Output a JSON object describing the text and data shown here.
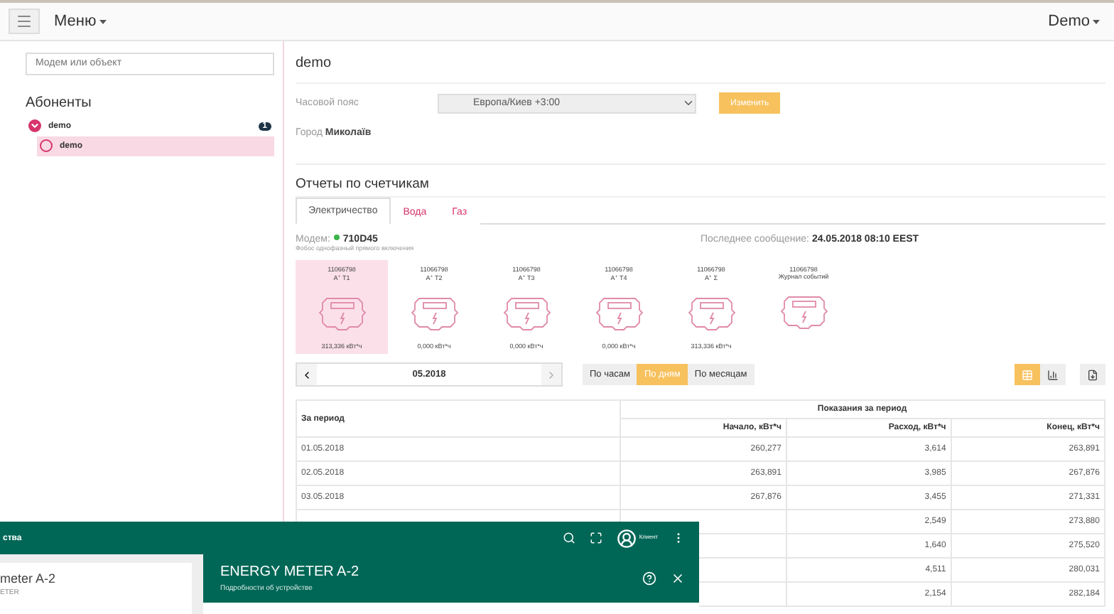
{
  "navbar": {
    "menu_label": "Меню",
    "user_label": "Demo"
  },
  "sidebar": {
    "search": {
      "placeholder": "Модем или объект"
    },
    "heading": "Абоненты",
    "tree": [
      {
        "label": "demo",
        "badge": "1",
        "expanded": true,
        "selected": false,
        "children": [
          {
            "label": "demo",
            "selected": true
          }
        ]
      }
    ]
  },
  "main": {
    "title": "demo",
    "timezone": {
      "label": "Часовой пояс",
      "value": "Европа/Киев +3:00",
      "button": "Изменить"
    },
    "city": "Город **Миколаїв**",
    "reports_heading": "Отчеты по счетчикам",
    "tabs": [
      {
        "label": "Электричество",
        "selected": true
      },
      {
        "label": "Вода",
        "selected": false
      },
      {
        "label": "Газ",
        "selected": false
      }
    ],
    "modem": {
      "label": "Модем:",
      "id": "710D45",
      "online": true,
      "description": "Фобос однофазный прямого включения"
    },
    "last_message": {
      "label": "Последнее сообщение:",
      "value": "24.05.2018 08:10 EEST"
    },
    "meters": [
      {
        "number": "11066798",
        "channel": "A⁺ T1",
        "reading": "313,336 кВт*ч",
        "selected": true
      },
      {
        "number": "11066798",
        "channel": "A⁺ T2",
        "reading": "0,000 кВт*ч",
        "selected": false
      },
      {
        "number": "11066798",
        "channel": "A⁺ T3",
        "reading": "0,000 кВт*ч",
        "selected": false
      },
      {
        "number": "11066798",
        "channel": "A⁺ T4",
        "reading": "0,000 кВт*ч",
        "selected": false
      },
      {
        "number": "11066798",
        "channel": "A⁺ Σ",
        "reading": "313,336 кВт*ч",
        "selected": false
      },
      {
        "number": "11066798",
        "channel": "Журнал событий",
        "selected": false
      }
    ],
    "period": {
      "value": "05.2018"
    },
    "grouping": [
      {
        "label": "По часам",
        "selected": false
      },
      {
        "label": "По дням",
        "selected": true
      },
      {
        "label": "По месяцам",
        "selected": false
      }
    ],
    "views": [
      {
        "kind": "table",
        "selected": true
      },
      {
        "kind": "chart",
        "selected": false
      }
    ],
    "table": {
      "period_header": "За период",
      "group_header": "Показания за период",
      "columns": [
        "Начало, кВт*ч",
        "Расход, кВт*ч",
        "Конец, кВт*ч"
      ],
      "rows": [
        {
          "period": "01.05.2018",
          "start": "260,277",
          "usage": "3,614",
          "end": "263,891"
        },
        {
          "period": "02.05.2018",
          "start": "263,891",
          "usage": "3,985",
          "end": "267,876"
        },
        {
          "period": "03.05.2018",
          "start": "267,876",
          "usage": "3,455",
          "end": "271,331"
        },
        {
          "usage": "2,549",
          "end": "273,880"
        },
        {
          "usage": "1,640",
          "end": "275,520"
        },
        {
          "usage": "4,511",
          "end": "280,031"
        },
        {
          "usage": "2,154",
          "end": "282,184"
        }
      ]
    }
  },
  "overlay": {
    "appbar_title": "ства",
    "user_label": "Клиент",
    "device_name": "meter A-2",
    "device_type": "ETER",
    "panel_title": "ENERGY METER A-2",
    "panel_subtitle": "Подробности об устройстве"
  }
}
